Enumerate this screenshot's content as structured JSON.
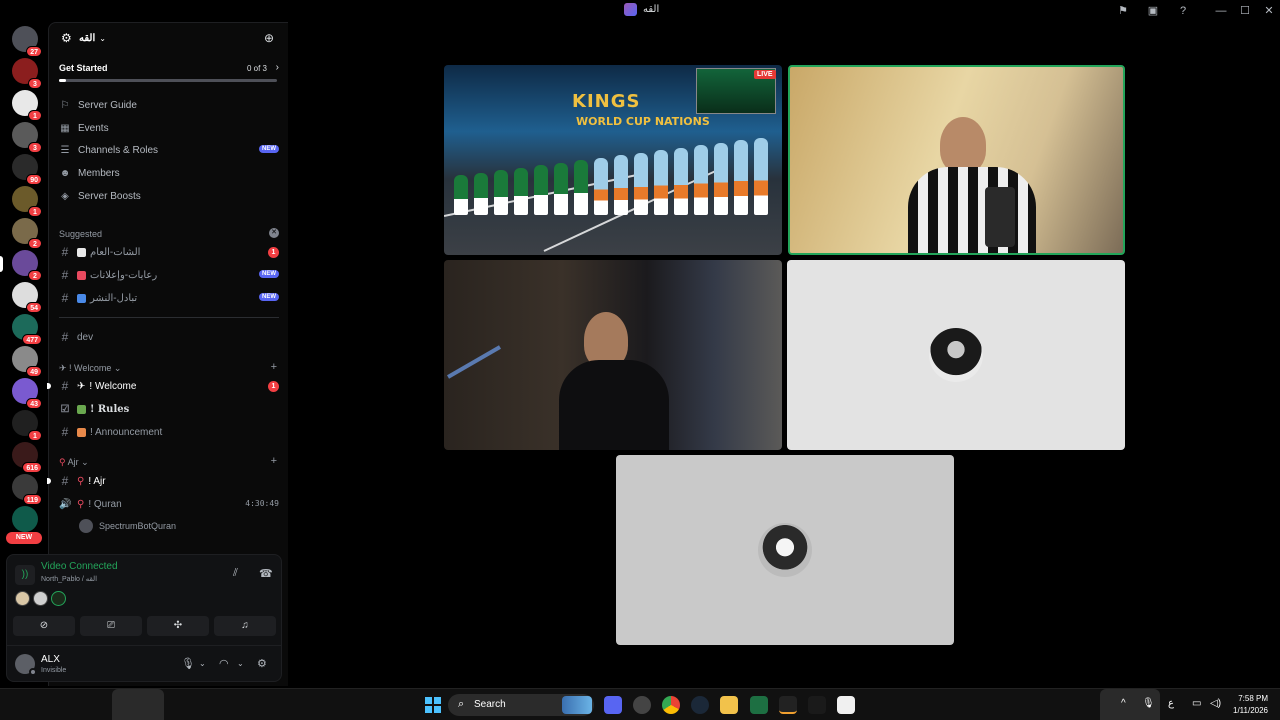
{
  "window": {
    "title": "القه"
  },
  "rail": {
    "servers": [
      {
        "badge": "27",
        "color": "#4e5058"
      },
      {
        "badge": "3",
        "color": "#8b1e1e"
      },
      {
        "badge": "1",
        "color": "#e8e8e8"
      },
      {
        "badge": "3",
        "color": "#5a5a5a"
      },
      {
        "badge": "90",
        "color": "#2a2a2a"
      },
      {
        "badge": "1",
        "color": "#6b5a2a"
      },
      {
        "badge": "2",
        "color": "#7a6a4a"
      },
      {
        "badge": "2",
        "color": "#6a4a9a"
      },
      {
        "badge": "54",
        "color": "#dddddd"
      },
      {
        "badge": "477",
        "color": "#1c6a5a"
      },
      {
        "badge": "49",
        "color": "#8a8a8a"
      },
      {
        "badge": "43",
        "color": "#7a5ad0"
      },
      {
        "badge": "1",
        "color": "#202020"
      },
      {
        "badge": "616",
        "color": "#3a1a1a"
      },
      {
        "badge": "119",
        "color": "#3a3a3a"
      },
      {
        "badge": "",
        "color": "#0f5a4a"
      }
    ],
    "new_label": "NEW"
  },
  "server": {
    "name": "القه",
    "get_started": {
      "label": "Get Started",
      "count": "0 of 3",
      "progress": 0.03
    }
  },
  "menu": [
    {
      "label": "Server Guide",
      "icon": "signpost-icon"
    },
    {
      "label": "Events",
      "icon": "calendar-icon"
    },
    {
      "label": "Channels & Roles",
      "icon": "list-icon",
      "badge": "NEW"
    },
    {
      "label": "Members",
      "icon": "members-icon"
    },
    {
      "label": "Server Boosts",
      "icon": "boost-icon"
    }
  ],
  "suggested": {
    "title": "Suggested",
    "channels": [
      {
        "label": "الشات-العام",
        "emoji_color": "#e8e8e8",
        "badge": "1"
      },
      {
        "label": "رعايات-وإعلانات",
        "emoji_color": "#e84a5f",
        "badge_new": "NEW"
      },
      {
        "label": "تبادل-النشر",
        "emoji_color": "#4a8ae8",
        "badge_new": "NEW"
      }
    ]
  },
  "channels": {
    "dev": "dev",
    "welcome_category": "! Welcome",
    "welcome": "! Welcome",
    "welcome_badge": "1",
    "rules": "! Rules",
    "announcement": "! Announcement",
    "ajr_category": "Ajr",
    "ajr": "! Ajr",
    "quran": "! Quran",
    "quran_time": "4:30:49",
    "voice_user": "SpectrumBotQuran"
  },
  "voice_panel": {
    "title": "Video Connected",
    "subtitle": "North_Pablo / القه"
  },
  "user": {
    "name": "ALX",
    "status": "Invisible"
  },
  "video": {
    "kings_title": "KINGS",
    "kings_sub": "WORLD CUP NATIONS",
    "live": "LIVE"
  },
  "taskbar": {
    "search": "Search",
    "time": "7:58 PM",
    "date": "1/11/2026",
    "lang": "ع"
  }
}
